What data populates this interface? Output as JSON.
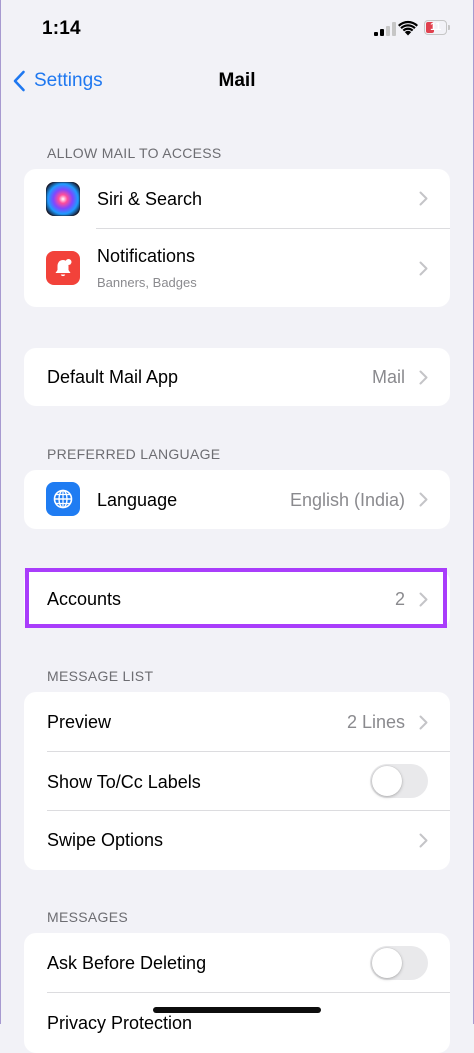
{
  "status_bar": {
    "time": "1:14",
    "battery": "11"
  },
  "nav": {
    "back_label": "Settings",
    "title": "Mail"
  },
  "sections": {
    "allow_access": {
      "header": "ALLOW MAIL TO ACCESS",
      "siri": {
        "label": "Siri & Search"
      },
      "notifications": {
        "label": "Notifications",
        "sublabel": "Banners, Badges"
      }
    },
    "default_app": {
      "label": "Default Mail App",
      "value": "Mail"
    },
    "preferred_language": {
      "header": "PREFERRED LANGUAGE",
      "language": {
        "label": "Language",
        "value": "English (India)"
      }
    },
    "accounts": {
      "label": "Accounts",
      "value": "2"
    },
    "message_list": {
      "header": "MESSAGE LIST",
      "preview": {
        "label": "Preview",
        "value": "2 Lines"
      },
      "show_to_cc": {
        "label": "Show To/Cc Labels",
        "on": false
      },
      "swipe_options": {
        "label": "Swipe Options"
      }
    },
    "messages": {
      "header": "MESSAGES",
      "ask_before_deleting": {
        "label": "Ask Before Deleting",
        "on": false
      },
      "privacy_protection": {
        "label": "Privacy Protection"
      }
    }
  },
  "colors": {
    "accent": "#1f78f0",
    "highlight": "#a93dfb",
    "background": "#f2f2f7"
  }
}
